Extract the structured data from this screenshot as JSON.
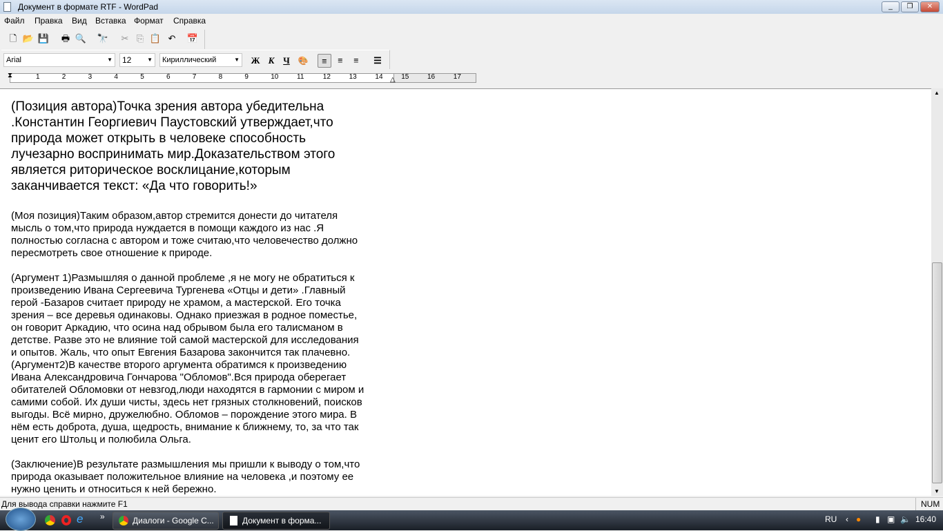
{
  "window": {
    "title": "Документ в формате RTF - WordPad",
    "minimize": "_",
    "maximize": "❐",
    "close": "✕"
  },
  "menu": [
    "Файл",
    "Правка",
    "Вид",
    "Вставка",
    "Формат",
    "Справка"
  ],
  "toolbar": [
    {
      "name": "new-icon",
      "g": "🗋"
    },
    {
      "name": "open-icon",
      "g": "📂"
    },
    {
      "name": "save-icon",
      "g": "💾"
    },
    {
      "name": "print-icon",
      "g": "🖶"
    },
    {
      "name": "print-preview-icon",
      "g": "🔍"
    },
    {
      "name": "find-icon",
      "g": "🔭"
    },
    {
      "name": "cut-icon",
      "g": "✂"
    },
    {
      "name": "copy-icon",
      "g": "⎘"
    },
    {
      "name": "paste-icon",
      "g": "📋"
    },
    {
      "name": "undo-icon",
      "g": "↶"
    },
    {
      "name": "datetime-icon",
      "g": "📅"
    }
  ],
  "format": {
    "font": "Arial",
    "size": "12",
    "script": "Кириллический",
    "bold": "Ж",
    "italic": "К",
    "underline": "Ч",
    "color": "🎨"
  },
  "ruler": [
    "1",
    "2",
    "3",
    "4",
    "5",
    "6",
    "7",
    "8",
    "9",
    "10",
    "11",
    "12",
    "13",
    "14",
    "15",
    "16",
    "17"
  ],
  "document": {
    "heading": [
      "(Позиция автора)Точка зрения автора убедительна",
      ".Константин Георгиевич Паустовский утверждает,что",
      "природа может открыть в человеке способность",
      "лучезарно воспринимать мир.Доказательством этого",
      "является риторическое восклицание,которым",
      "заканчивается текст: «Да что говорить!»"
    ],
    "body": [
      [
        "(Моя позиция)Таким образом,автор стремится донести до читателя",
        "мысль о том,что природа нуждается в помощи каждого из нас .Я",
        "полностью согласна с автором и тоже считаю,что человечество должно",
        "пересмотреть свое отношение к природе."
      ],
      [
        "(Аргумент 1)Размышляя о данной проблеме ,я не могу не обратиться к",
        "произведению Ивана Сергеевича Тургенева «Отцы и дети» .Главный",
        "герой -Базаров считает природу не храмом, а мастерской. Его точка",
        "зрения – все деревья одинаковы. Однако приезжая в родное поместье,",
        "он говорит Аркадию, что осина над обрывом была его талисманом в",
        "детстве. Разве это не влияние той самой мастерской для исследования",
        "и опытов. Жаль, что опыт Евгения Базарова закончится так плачевно.",
        "(Аргумент2)В качестве второго аргумента обратимся к произведению",
        "Ивана Александровича Гончарова \"Обломов\".Вся природа оберегает",
        "обитателей Обломовки от невзгод,люди находятся в гармонии с миром и",
        "самими собой. Их души чисты, здесь нет грязных столкновений, поисков",
        "выгоды. Всё мирно, дружелюбно. Обломов – порождение этого мира. В",
        "нём есть доброта, душа, щедрость, внимание к ближнему, то, за что так",
        "ценит его Штольц и полюбила Ольга."
      ],
      [
        "(Заключение)В результате размышления мы пришли к выводу о том,что",
        "природа оказывает положительное влияние на человека ,и поэтому ее",
        "нужно ценить и относиться к ней бережно."
      ]
    ]
  },
  "status": {
    "help": "Для вывода справки нажмите F1",
    "num": "NUM"
  },
  "taskbar": {
    "tasks": [
      "Диалоги - Google C...",
      "Документ в форма..."
    ],
    "lang": "RU",
    "clock": "16:40",
    "chevron": "»"
  }
}
